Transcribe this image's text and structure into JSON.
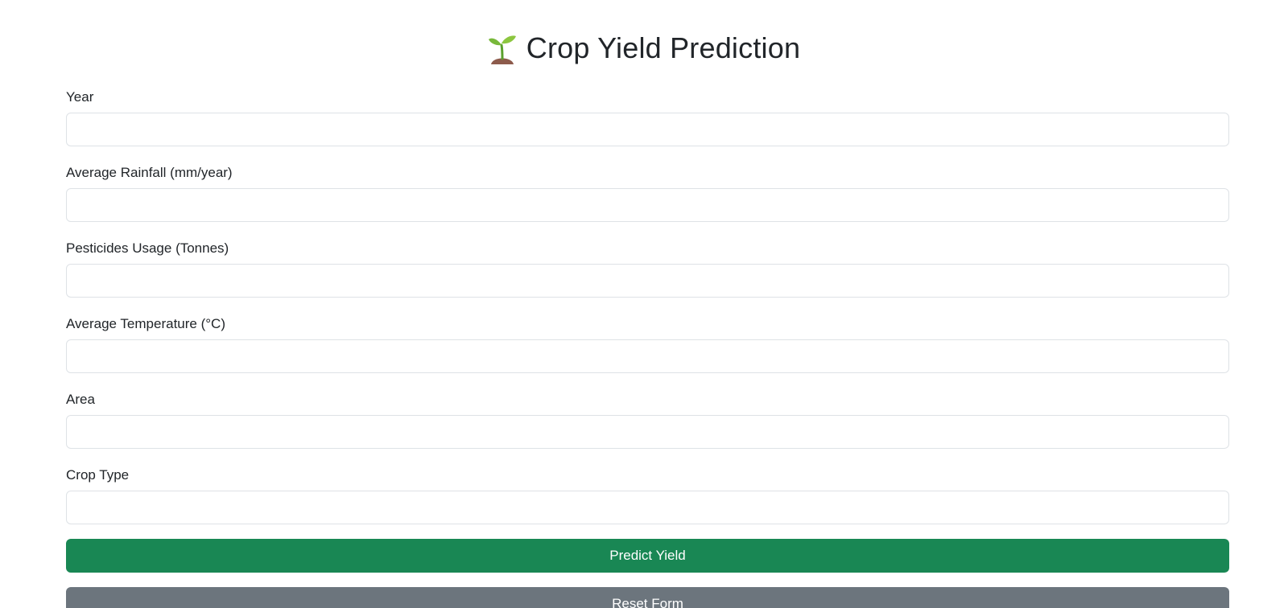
{
  "header": {
    "title": "Crop Yield Prediction",
    "icon": "seedling-icon"
  },
  "form": {
    "fields": [
      {
        "label": "Year",
        "value": "",
        "placeholder": ""
      },
      {
        "label": "Average Rainfall (mm/year)",
        "value": "",
        "placeholder": ""
      },
      {
        "label": "Pesticides Usage (Tonnes)",
        "value": "",
        "placeholder": ""
      },
      {
        "label": "Average Temperature (°C)",
        "value": "",
        "placeholder": ""
      },
      {
        "label": "Area",
        "value": "",
        "placeholder": ""
      },
      {
        "label": "Crop Type",
        "value": "",
        "placeholder": ""
      }
    ],
    "predict_label": "Predict Yield",
    "reset_label": "Reset Form"
  },
  "colors": {
    "predict_button": "#198754",
    "reset_button": "#6c757d",
    "input_border": "#dee2e6",
    "text": "#212529"
  }
}
